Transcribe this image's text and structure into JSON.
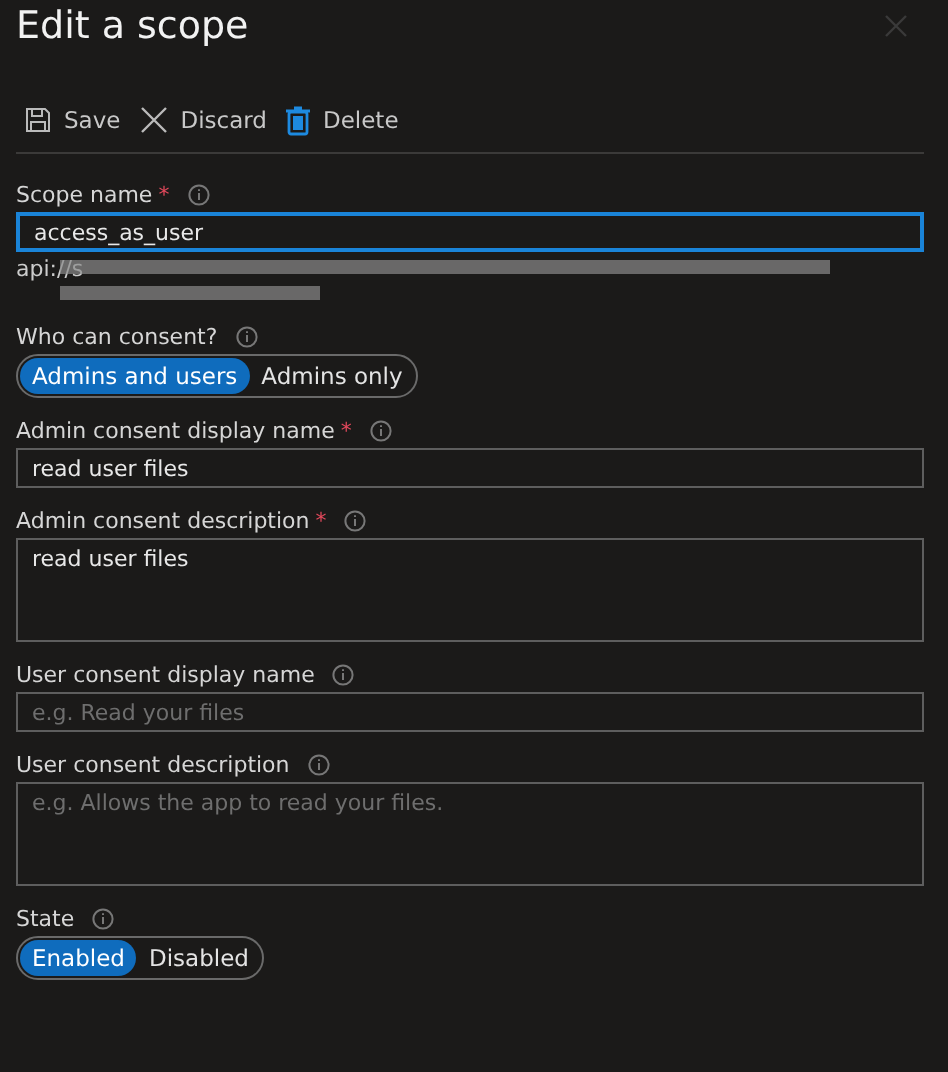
{
  "title": "Edit a scope",
  "toolbar": [
    {
      "kind": "save",
      "label": "Save"
    },
    {
      "kind": "discard",
      "label": "Discard"
    },
    {
      "kind": "delete",
      "label": "Delete"
    }
  ],
  "fields": [
    {
      "kind": "text",
      "label": "Scope name",
      "required_mark": "*",
      "focused": true,
      "value": "access_as_user",
      "hint": "api://s"
    },
    {
      "kind": "choice",
      "label": "Who can consent?",
      "options": [
        {
          "label": "Admins and users",
          "selected": true
        },
        {
          "label": "Admins only",
          "selected": false
        }
      ]
    },
    {
      "kind": "text",
      "label": "Admin consent display name",
      "required_mark": "*",
      "focused": false,
      "value": "read user files"
    },
    {
      "kind": "area",
      "label": "Admin consent description",
      "required_mark": "*",
      "focused": false,
      "value": "read user files"
    },
    {
      "kind": "text",
      "label": "User consent display name",
      "focused": false,
      "placeholder": "e.g. Read your files"
    },
    {
      "kind": "area",
      "label": "User consent description",
      "focused": false,
      "placeholder": "e.g. Allows the app to read your files."
    },
    {
      "kind": "choice",
      "label": "State",
      "options": [
        {
          "label": "Enabled",
          "selected": true
        },
        {
          "label": "Disabled",
          "selected": false
        }
      ]
    }
  ]
}
